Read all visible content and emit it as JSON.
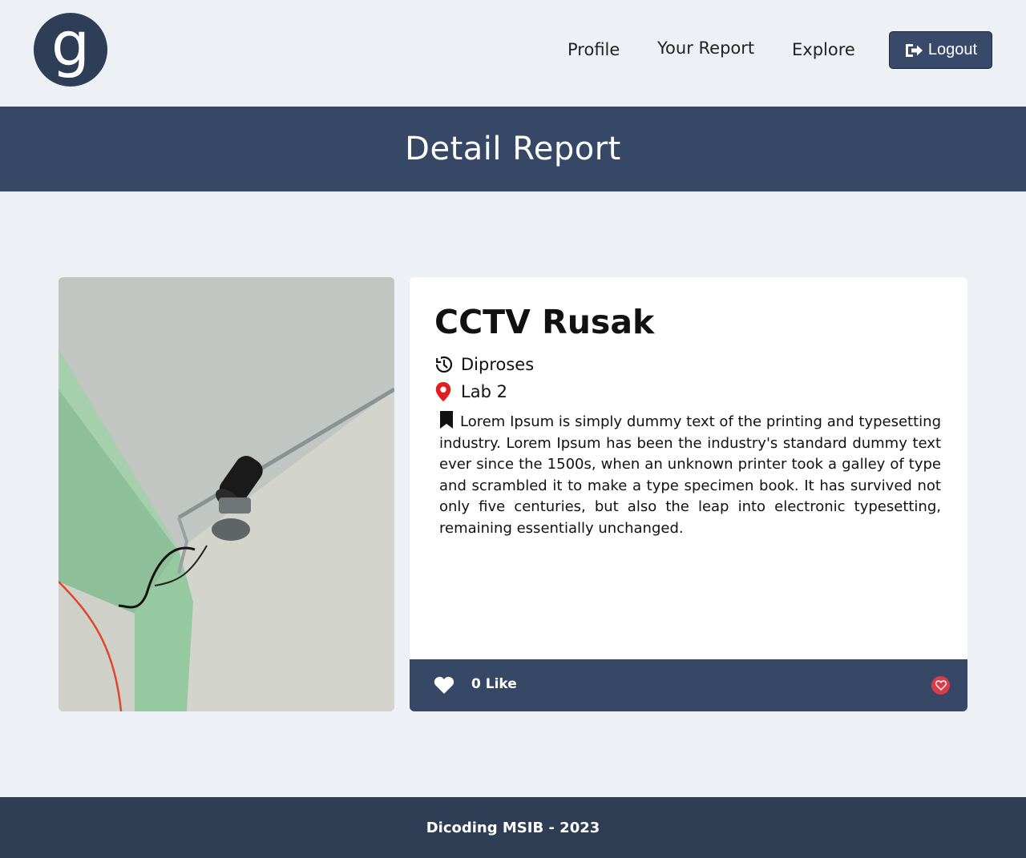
{
  "nav": {
    "logo_glyph": "g",
    "links": [
      "Profile",
      "Your Report",
      "Explore"
    ],
    "logout_label": "Logout"
  },
  "banner": {
    "title": "Detail Report"
  },
  "report": {
    "title": "CCTV Rusak",
    "status": "Diproses",
    "location": "Lab 2",
    "description": "Lorem Ipsum is simply dummy text of the printing and typesetting industry. Lorem Ipsum has been the industry's standard dummy text ever since the 1500s, when an unknown printer took a galley of type and scrambled it to make a type specimen book. It has survived not only five centuries, but also the leap into electronic typesetting, remaining essentially unchanged.",
    "likes": "0 Like"
  },
  "footer": {
    "text": "Dicoding MSIB - 2023"
  },
  "colors": {
    "background": "#edf1f6",
    "primary": "#374867",
    "footer": "#2e3d54",
    "location_pin": "#e01e1e",
    "like_button": "#dc3b4a"
  },
  "icons": {
    "logout": "logout-icon",
    "status": "history-icon",
    "location": "map-pin-icon",
    "description": "bookmark-icon",
    "like": "heart-icon"
  }
}
